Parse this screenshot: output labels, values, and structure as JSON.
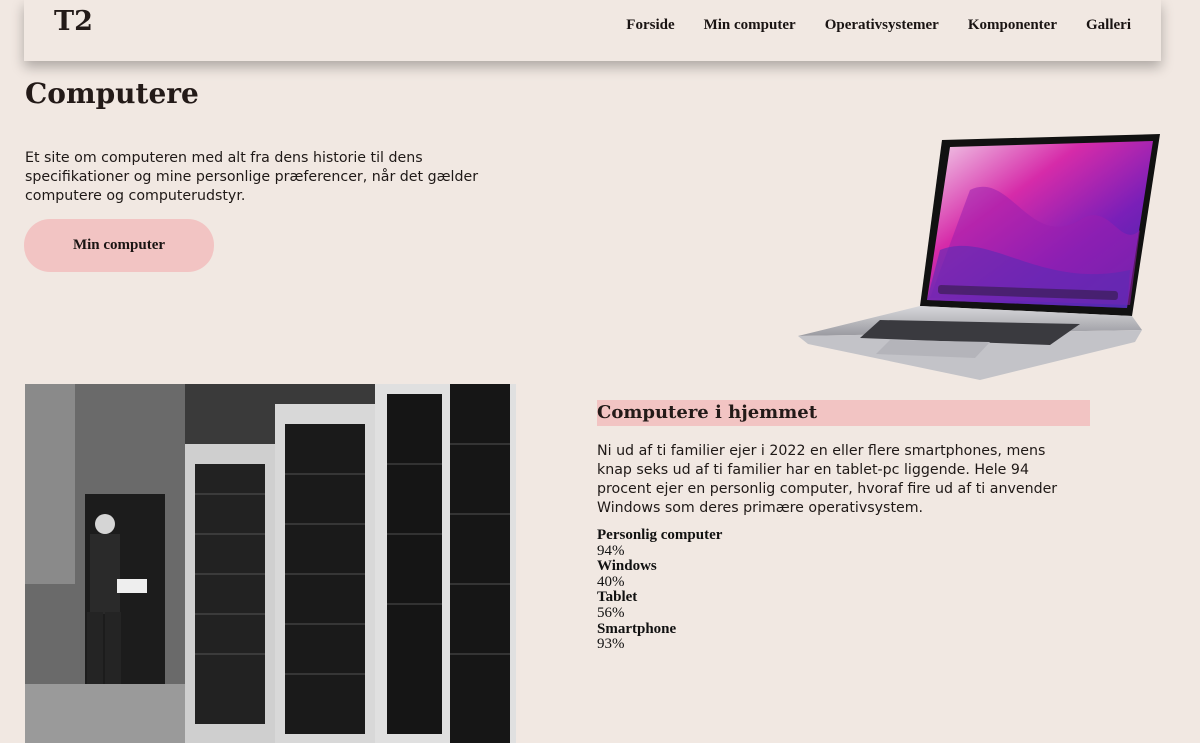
{
  "header": {
    "logo": "T2",
    "nav": [
      "Forside",
      "Min computer",
      "Operativsystemer",
      "Komponenter",
      "Galleri"
    ]
  },
  "hero": {
    "title": "Computere",
    "intro": "Et site om computeren med alt fra dens historie til dens specifikationer og mine personlige præferencer, når det gælder computere og computerudstyr.",
    "cta_label": "Min computer"
  },
  "home_section": {
    "title": "Computere i hjemmet",
    "text": "Ni ud af ti familier ejer i 2022 en eller flere smartphones, mens knap seks ud af ti familier har en tablet-pc liggende. Hele 94 procent ejer en personlig computer, hvoraf fire ud af ti anvender Windows som deres primære operativsystem.",
    "stats": [
      {
        "label": "Personlig computer",
        "value": "94%"
      },
      {
        "label": "Windows",
        "value": "40%"
      },
      {
        "label": "Tablet",
        "value": "56%"
      },
      {
        "label": "Smartphone",
        "value": "93%"
      }
    ]
  },
  "colors": {
    "background": "#f1e8e2",
    "accent_pink": "#f2c4c3",
    "text": "#231a18"
  },
  "images": {
    "laptop": "laptop-image",
    "historic": "historic-computer-photo"
  }
}
